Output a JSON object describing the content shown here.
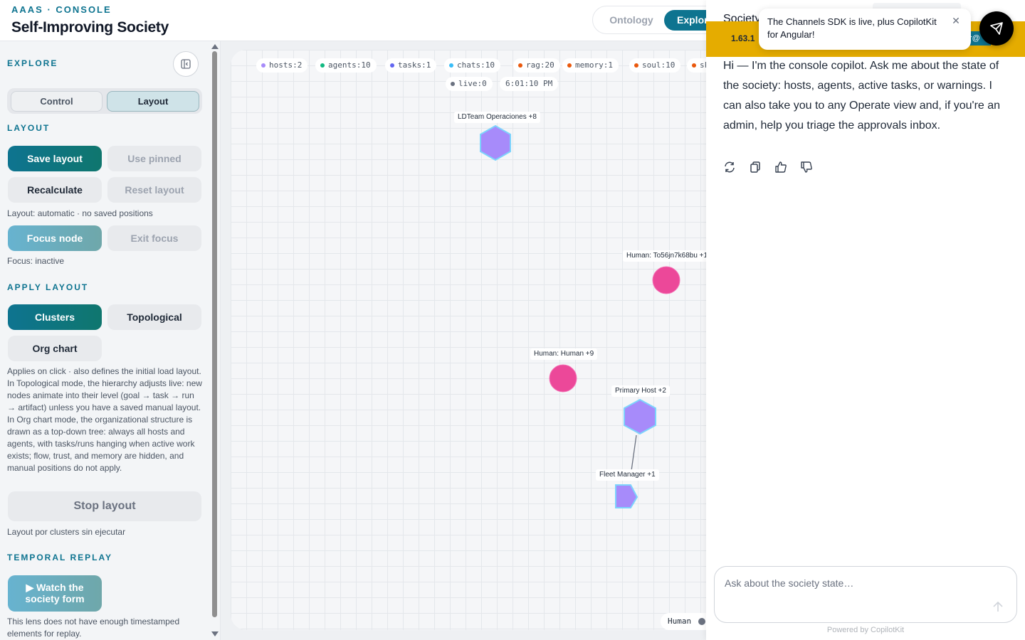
{
  "header": {
    "kicker": "AAAS · CONSOLE",
    "title": "Self-Improving Society",
    "view_tabs": [
      "Ontology",
      "Explore"
    ]
  },
  "sidebar": {
    "explore_label": "EXPLORE",
    "mode_tabs": [
      "Control",
      "Layout"
    ],
    "layout_section": "LAYOUT",
    "save_layout": "Save layout",
    "use_pinned": "Use pinned",
    "recalculate": "Recalculate",
    "reset_layout": "Reset layout",
    "layout_status": "Layout: automatic · no saved positions",
    "focus_node": "Focus node",
    "exit_focus": "Exit focus",
    "focus_status": "Focus: inactive",
    "apply_section": "APPLY LAYOUT",
    "clusters": "Clusters",
    "topological": "Topological",
    "org_chart": "Org chart",
    "apply_note": "Applies on click · also defines the initial load layout. In Topological mode, the hierarchy adjusts live: new nodes animate into their level (goal → task → run → artifact) unless you have a saved manual layout. In Org chart mode, the organizational structure is drawn as a top-down tree: always all hosts and agents, with tasks/runs hanging when active work exists; flow, trust, and memory are hidden, and manual positions do not apply.",
    "stop_layout": "Stop layout",
    "stop_note": "Layout por clusters sin ejecutar",
    "temporal_section": "TEMPORAL REPLAY",
    "watch_line1": "▶ Watch the",
    "watch_line2": "society form",
    "replay_note": "This lens does not have enough timestamped elements for replay."
  },
  "canvas": {
    "chips": [
      {
        "text": "hosts:2",
        "color": "#a78bfa"
      },
      {
        "text": "agents:10",
        "color": "#10b981"
      },
      {
        "text": "tasks:1",
        "color": "#6366f1"
      },
      {
        "text": "chats:10",
        "color": "#38bdf8"
      },
      {
        "text": "rag:20",
        "color": "#ea580c"
      },
      {
        "text": "memory:1",
        "color": "#ea580c"
      },
      {
        "text": "soul:10",
        "color": "#ea580c"
      },
      {
        "text": "sk",
        "color": "#ea580c"
      }
    ],
    "live": "live:0",
    "live_color": "#6b7280",
    "clock": "6:01:10 PM",
    "node_labels": {
      "team": "LDTeam Operaciones  +8",
      "human1": "Human: To56jn7k68bu  +1",
      "human2": "Human: Human  +9",
      "primary": "Primary Host  +2",
      "fleet": "Fleet Manager  +1"
    },
    "legend_label": "Human"
  },
  "copilot": {
    "title": "Society",
    "version": "1.63.1",
    "toast": "The Channels SDK is live, plus CopilotKit for Angular!",
    "message": "Hi — I'm the console copilot. Ask me about the state of the society: hosts, agents, active tasks, or warnings. I can also take you to any Operate view and, if you're an admin, help you triage the approvals inbox.",
    "input_placeholder": "Ask about the society state…",
    "powered_by": "Powered by CopilotKit"
  },
  "colors": {
    "accent": "#0e7490",
    "host": "#a78bfa",
    "human": "#ec4899",
    "banner": "#e5ac00"
  }
}
